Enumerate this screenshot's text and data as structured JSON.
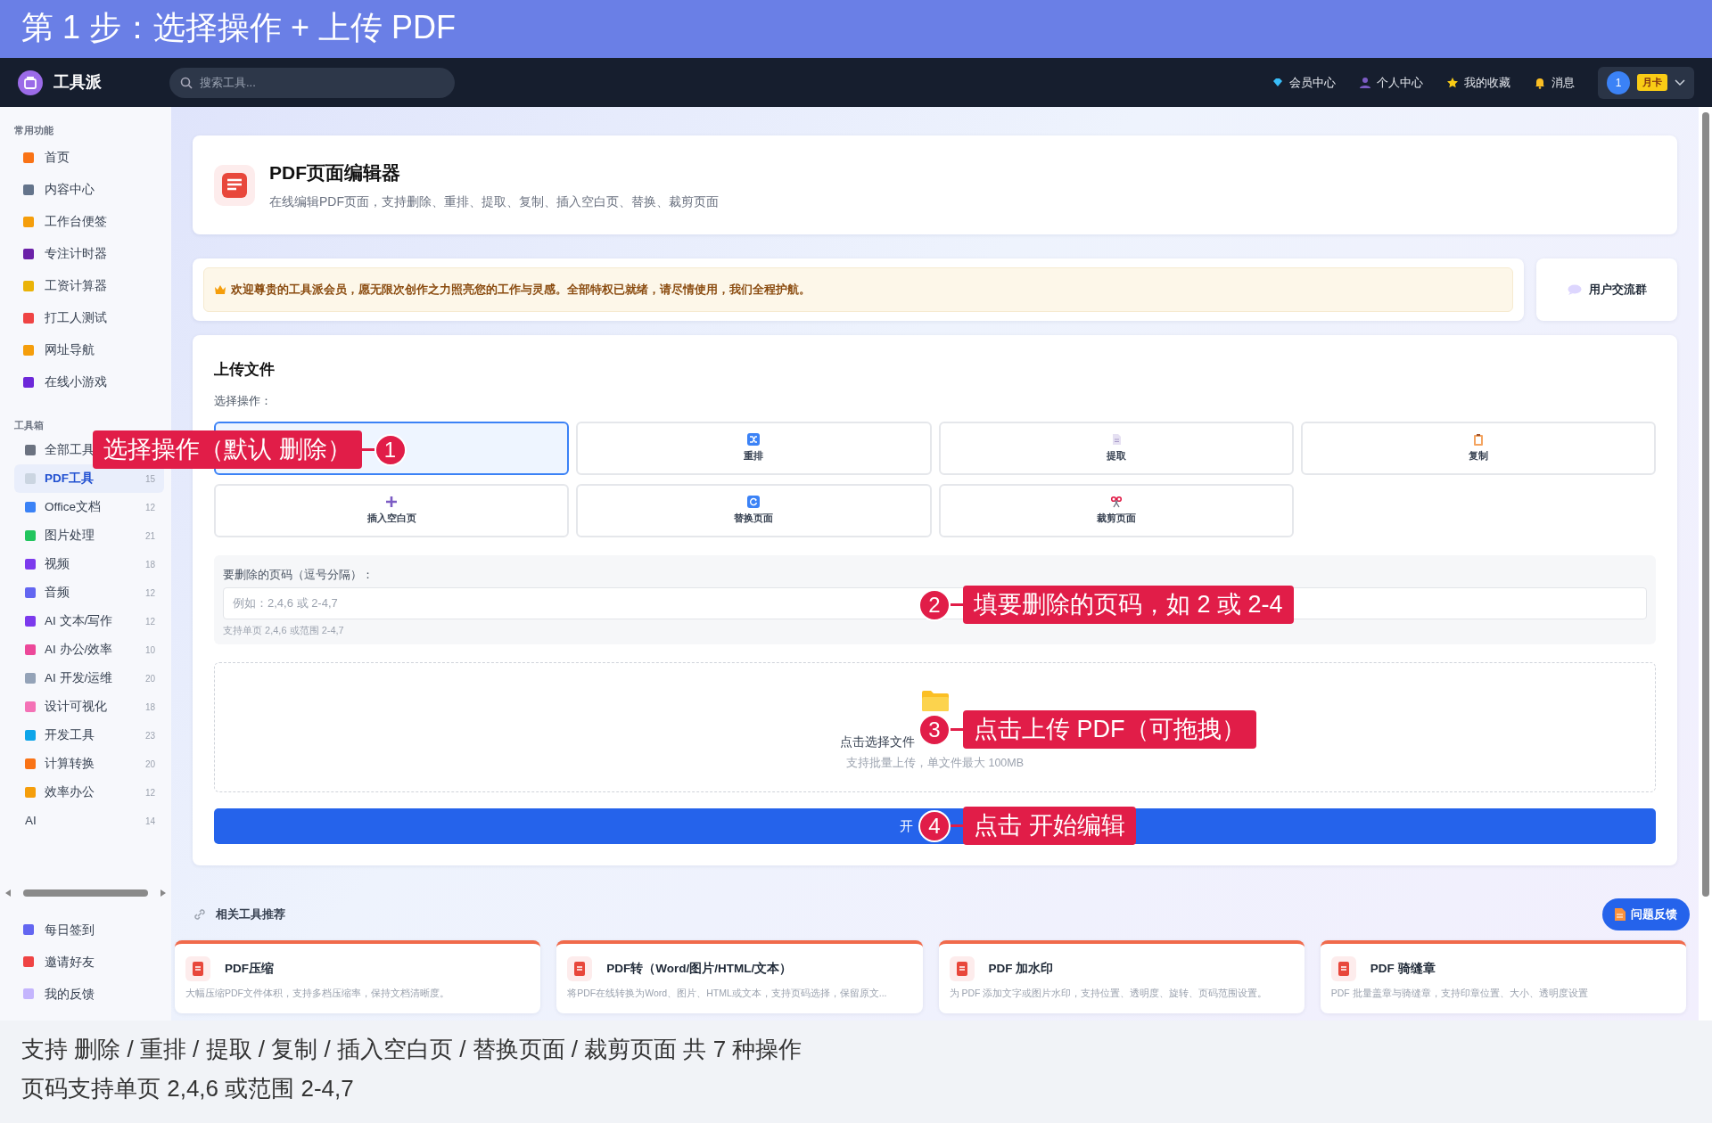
{
  "banner": {
    "title": "第 1 步：选择操作 + 上传 PDF"
  },
  "navbar": {
    "brand": "工具派",
    "search": {
      "placeholder": "搜索工具..."
    },
    "links": [
      "会员中心",
      "个人中心",
      "我的收藏",
      "消息"
    ],
    "user": {
      "number": "1",
      "tag": "月卡"
    }
  },
  "sidebar": {
    "sections": [
      {
        "title": "常用功能",
        "items": [
          {
            "label": "首页",
            "selected": false
          },
          {
            "label": "内容中心",
            "selected": false
          },
          {
            "label": "工作台便签",
            "selected": false
          },
          {
            "label": "专注计时器",
            "selected": false
          },
          {
            "label": "工资计算器",
            "selected": false
          },
          {
            "label": "打工人测试",
            "selected": false
          },
          {
            "label": "网址导航",
            "selected": false
          },
          {
            "label": "在线小游戏",
            "selected": false
          }
        ]
      },
      {
        "title": "工具箱",
        "items": [
          {
            "label": "全部工具",
            "selected": false
          },
          {
            "label": "PDF工具",
            "count": "15",
            "selected": true
          },
          {
            "label": "Office文档",
            "count": "12",
            "selected": false
          },
          {
            "label": "图片处理",
            "count": "21",
            "selected": false
          },
          {
            "label": "视频",
            "count": "18",
            "selected": false
          },
          {
            "label": "音频",
            "count": "12",
            "selected": false
          },
          {
            "label": "AI 文本/写作",
            "count": "12",
            "selected": false
          },
          {
            "label": "AI 办公/效率",
            "count": "10",
            "selected": false
          },
          {
            "label": "AI 开发/运维",
            "count": "20",
            "selected": false
          },
          {
            "label": "设计可视化",
            "count": "18",
            "selected": false
          },
          {
            "label": "开发工具",
            "count": "23",
            "selected": false
          },
          {
            "label": "计算转换",
            "count": "20",
            "selected": false
          },
          {
            "label": "效率办公",
            "count": "12",
            "selected": false
          },
          {
            "label": "AI",
            "count": "14",
            "selected": false
          }
        ]
      }
    ],
    "footer_items": [
      "每日签到",
      "邀请好友",
      "我的反馈"
    ]
  },
  "tool_header": {
    "title": "PDF页面编辑器",
    "description": "在线编辑PDF页面，支持删除、重排、提取、复制、插入空白页、替换、裁剪页面"
  },
  "notice": {
    "text": "欢迎尊贵的工具派会员，愿无限次创作之力照亮您的工作与灵感。全部特权已就绪，请尽情使用，我们全程护航。"
  },
  "group_button": "用户交流群",
  "upload": {
    "title": "上传文件",
    "operation_label": "选择操作：",
    "operations": [
      {
        "selected": true
      },
      {
        "label": "重排",
        "selected": false
      },
      {
        "label": "提取",
        "selected": false
      },
      {
        "label": "复制",
        "selected": false
      },
      {
        "label": "插入空白页",
        "selected": false
      },
      {
        "label": "替换页面",
        "selected": false
      },
      {
        "label": "裁剪页面",
        "selected": false
      }
    ],
    "pages_field": {
      "label": "要删除的页码（逗号分隔）：",
      "placeholder": "例如：2,4,6 或 2-4,7",
      "hint": "支持单页 2,4,6 或范围 2-4,7"
    },
    "dropzone": {
      "text": "点击选择文件",
      "hint": "支持批量上传，单文件最大 100MB"
    },
    "start_button": "开"
  },
  "related": {
    "title": "相关工具推荐",
    "tools": [
      {
        "name": "PDF压缩",
        "description": "大幅压缩PDF文件体积，支持多档压缩率，保持文档清晰度。"
      },
      {
        "name": "PDF转（Word/图片/HTML/文本）",
        "description": "将PDF在线转换为Word、图片、HTML或文本，支持页码选择，保留原文..."
      },
      {
        "name": "PDF 加水印",
        "description": "为 PDF 添加文字或图片水印，支持位置、透明度、旋转、页码范围设置。"
      },
      {
        "name": "PDF 骑缝章",
        "description": "PDF 批量盖章与骑缝章，支持印章位置、大小、透明度设置"
      }
    ]
  },
  "feedback_button": "问题反馈",
  "callouts": [
    {
      "number": "1",
      "text": "选择操作（默认 删除）"
    },
    {
      "number": "2",
      "text": "填要删除的页码，如 2 或 2-4"
    },
    {
      "number": "3",
      "text": "点击上传 PDF（可拖拽）"
    },
    {
      "number": "4",
      "text": "点击 开始编辑"
    }
  ],
  "caption": [
    "支持 删除 / 重排 / 提取 / 复制 / 插入空白页 / 替换页面 / 裁剪页面 共 7 种操作",
    "页码支持单页 2,4,6 或范围 2-4,7"
  ]
}
